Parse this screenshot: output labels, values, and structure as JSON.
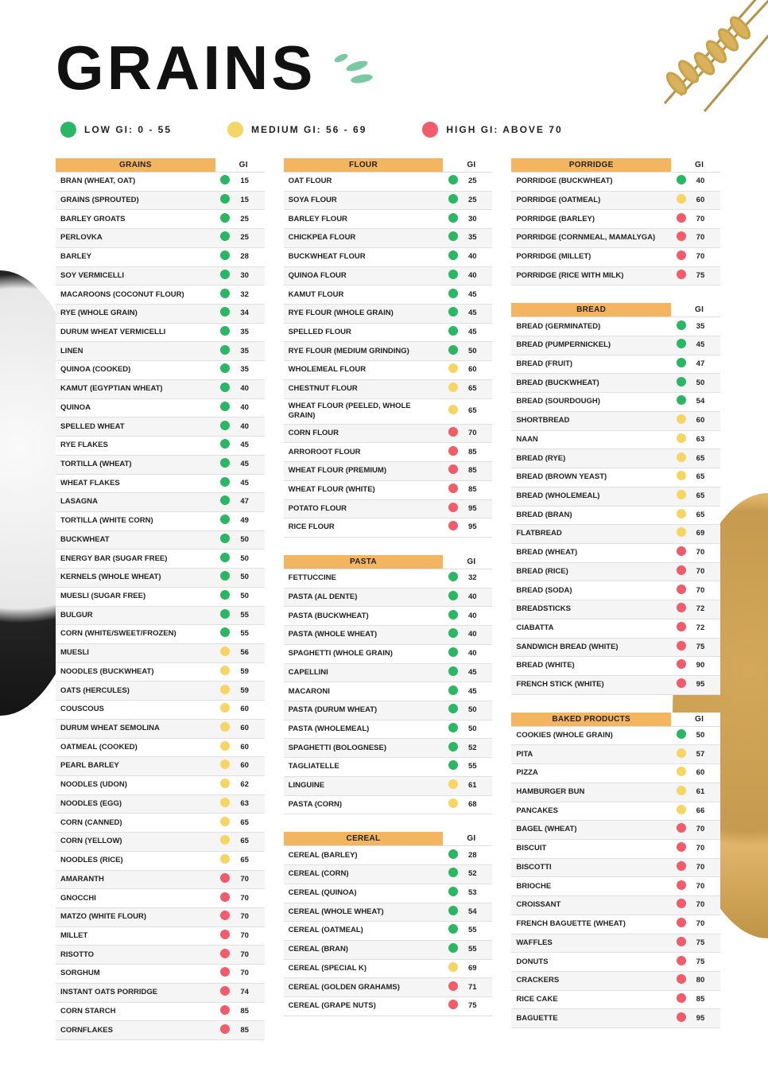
{
  "title": "GRAINS",
  "legend": {
    "low": {
      "label": "LOW GI: 0 - 55",
      "color": "#2ab764"
    },
    "med": {
      "label": "MEDIUM GI: 56 - 69",
      "color": "#f5d564"
    },
    "high": {
      "label": "HIGH GI: ABOVE 70",
      "color": "#f25b6a"
    }
  },
  "gi_header": "GI",
  "tables": {
    "grains": {
      "header": "GRAINS",
      "rows": [
        {
          "name": "BRAN (WHEAT, OAT)",
          "gi": 15,
          "level": "low"
        },
        {
          "name": "GRAINS (SPROUTED)",
          "gi": 15,
          "level": "low"
        },
        {
          "name": "BARLEY GROATS",
          "gi": 25,
          "level": "low"
        },
        {
          "name": "PERLOVKA",
          "gi": 25,
          "level": "low"
        },
        {
          "name": "BARLEY",
          "gi": 28,
          "level": "low"
        },
        {
          "name": "SOY VERMICELLI",
          "gi": 30,
          "level": "low"
        },
        {
          "name": "MACAROONS (COCONUT FLOUR)",
          "gi": 32,
          "level": "low"
        },
        {
          "name": "RYE (WHOLE GRAIN)",
          "gi": 34,
          "level": "low"
        },
        {
          "name": "DURUM WHEAT VERMICELLI",
          "gi": 35,
          "level": "low"
        },
        {
          "name": "LINEN",
          "gi": 35,
          "level": "low"
        },
        {
          "name": "QUINOA (COOKED)",
          "gi": 35,
          "level": "low"
        },
        {
          "name": "KAMUT (EGYPTIAN WHEAT)",
          "gi": 40,
          "level": "low"
        },
        {
          "name": "QUINOA",
          "gi": 40,
          "level": "low"
        },
        {
          "name": "SPELLED WHEAT",
          "gi": 40,
          "level": "low"
        },
        {
          "name": "RYE FLAKES",
          "gi": 45,
          "level": "low"
        },
        {
          "name": "TORTILLA (WHEAT)",
          "gi": 45,
          "level": "low"
        },
        {
          "name": "WHEAT FLAKES",
          "gi": 45,
          "level": "low"
        },
        {
          "name": "LASAGNA",
          "gi": 47,
          "level": "low"
        },
        {
          "name": "TORTILLA (WHITE CORN)",
          "gi": 49,
          "level": "low"
        },
        {
          "name": "BUCKWHEAT",
          "gi": 50,
          "level": "low"
        },
        {
          "name": "ENERGY BAR (SUGAR FREE)",
          "gi": 50,
          "level": "low"
        },
        {
          "name": "KERNELS (WHOLE WHEAT)",
          "gi": 50,
          "level": "low"
        },
        {
          "name": "MUESLI (SUGAR FREE)",
          "gi": 50,
          "level": "low"
        },
        {
          "name": "BULGUR",
          "gi": 55,
          "level": "low"
        },
        {
          "name": "CORN (WHITE/SWEET/FROZEN)",
          "gi": 55,
          "level": "low"
        },
        {
          "name": "MUESLI",
          "gi": 56,
          "level": "med"
        },
        {
          "name": "NOODLES (BUCKWHEAT)",
          "gi": 59,
          "level": "med"
        },
        {
          "name": "OATS (HERCULES)",
          "gi": 59,
          "level": "med"
        },
        {
          "name": "COUSCOUS",
          "gi": 60,
          "level": "med"
        },
        {
          "name": "DURUM WHEAT SEMOLINA",
          "gi": 60,
          "level": "med"
        },
        {
          "name": "OATMEAL (COOKED)",
          "gi": 60,
          "level": "med"
        },
        {
          "name": "PEARL BARLEY",
          "gi": 60,
          "level": "med"
        },
        {
          "name": "NOODLES (UDON)",
          "gi": 62,
          "level": "med"
        },
        {
          "name": "NOODLES (EGG)",
          "gi": 63,
          "level": "med"
        },
        {
          "name": "CORN (CANNED)",
          "gi": 65,
          "level": "med"
        },
        {
          "name": "CORN (YELLOW)",
          "gi": 65,
          "level": "med"
        },
        {
          "name": "NOODLES (RICE)",
          "gi": 65,
          "level": "med"
        },
        {
          "name": "AMARANTH",
          "gi": 70,
          "level": "high"
        },
        {
          "name": "GNOCCHI",
          "gi": 70,
          "level": "high"
        },
        {
          "name": "MATZO (WHITE FLOUR)",
          "gi": 70,
          "level": "high"
        },
        {
          "name": "MILLET",
          "gi": 70,
          "level": "high"
        },
        {
          "name": "RISOTTO",
          "gi": 70,
          "level": "high"
        },
        {
          "name": "SORGHUM",
          "gi": 70,
          "level": "high"
        },
        {
          "name": "INSTANT OATS PORRIDGE",
          "gi": 74,
          "level": "high"
        },
        {
          "name": "CORN STARCH",
          "gi": 85,
          "level": "high"
        },
        {
          "name": "CORNFLAKES",
          "gi": 85,
          "level": "high"
        }
      ]
    },
    "flour": {
      "header": "FLOUR",
      "rows": [
        {
          "name": "OAT FLOUR",
          "gi": 25,
          "level": "low"
        },
        {
          "name": "SOYA FLOUR",
          "gi": 25,
          "level": "low"
        },
        {
          "name": "BARLEY FLOUR",
          "gi": 30,
          "level": "low"
        },
        {
          "name": "CHICKPEA FLOUR",
          "gi": 35,
          "level": "low"
        },
        {
          "name": "BUCKWHEAT FLOUR",
          "gi": 40,
          "level": "low"
        },
        {
          "name": "QUINOA FLOUR",
          "gi": 40,
          "level": "low"
        },
        {
          "name": "KAMUT FLOUR",
          "gi": 45,
          "level": "low"
        },
        {
          "name": "RYE FLOUR (WHOLE GRAIN)",
          "gi": 45,
          "level": "low"
        },
        {
          "name": "SPELLED FLOUR",
          "gi": 45,
          "level": "low"
        },
        {
          "name": "RYE FLOUR (MEDIUM GRINDING)",
          "gi": 50,
          "level": "low"
        },
        {
          "name": "WHOLEMEAL FLOUR",
          "gi": 60,
          "level": "med"
        },
        {
          "name": "CHESTNUT FLOUR",
          "gi": 65,
          "level": "med"
        },
        {
          "name": "WHEAT FLOUR (PEELED, WHOLE GRAIN)",
          "gi": 65,
          "level": "med"
        },
        {
          "name": "CORN FLOUR",
          "gi": 70,
          "level": "high"
        },
        {
          "name": "ARROROOT FLOUR",
          "gi": 85,
          "level": "high"
        },
        {
          "name": "WHEAT FLOUR (PREMIUM)",
          "gi": 85,
          "level": "high"
        },
        {
          "name": "WHEAT FLOUR (WHITE)",
          "gi": 85,
          "level": "high"
        },
        {
          "name": "POTATO FLOUR",
          "gi": 95,
          "level": "high"
        },
        {
          "name": "RICE FLOUR",
          "gi": 95,
          "level": "high"
        }
      ]
    },
    "pasta": {
      "header": "PASTA",
      "rows": [
        {
          "name": "FETTUCCINE",
          "gi": 32,
          "level": "low"
        },
        {
          "name": "PASTA (AL DENTE)",
          "gi": 40,
          "level": "low"
        },
        {
          "name": "PASTA (BUCKWHEAT)",
          "gi": 40,
          "level": "low"
        },
        {
          "name": "PASTA (WHOLE WHEAT)",
          "gi": 40,
          "level": "low"
        },
        {
          "name": "SPAGHETTI (WHOLE GRAIN)",
          "gi": 40,
          "level": "low"
        },
        {
          "name": "CAPELLINI",
          "gi": 45,
          "level": "low"
        },
        {
          "name": "MACARONI",
          "gi": 45,
          "level": "low"
        },
        {
          "name": "PASTA (DURUM WHEAT)",
          "gi": 50,
          "level": "low"
        },
        {
          "name": "PASTA (WHOLEMEAL)",
          "gi": 50,
          "level": "low"
        },
        {
          "name": "SPAGHETTI (BOLOGNESE)",
          "gi": 52,
          "level": "low"
        },
        {
          "name": "TAGLIATELLE",
          "gi": 55,
          "level": "low"
        },
        {
          "name": "LINGUINE",
          "gi": 61,
          "level": "med"
        },
        {
          "name": "PASTA (CORN)",
          "gi": 68,
          "level": "med"
        }
      ]
    },
    "cereal": {
      "header": "CEREAL",
      "rows": [
        {
          "name": "CEREAL (BARLEY)",
          "gi": 28,
          "level": "low"
        },
        {
          "name": "CEREAL (CORN)",
          "gi": 52,
          "level": "low"
        },
        {
          "name": "CEREAL (QUINOA)",
          "gi": 53,
          "level": "low"
        },
        {
          "name": "CEREAL (WHOLE WHEAT)",
          "gi": 54,
          "level": "low"
        },
        {
          "name": "CEREAL (OATMEAL)",
          "gi": 55,
          "level": "low"
        },
        {
          "name": "CEREAL (BRAN)",
          "gi": 55,
          "level": "low"
        },
        {
          "name": "CEREAL (SPECIAL K)",
          "gi": 69,
          "level": "med"
        },
        {
          "name": "CEREAL (GOLDEN GRAHAMS)",
          "gi": 71,
          "level": "high"
        },
        {
          "name": "CEREAL (GRAPE NUTS)",
          "gi": 75,
          "level": "high"
        }
      ]
    },
    "porridge": {
      "header": "PORRIDGE",
      "rows": [
        {
          "name": "PORRIDGE (BUCKWHEAT)",
          "gi": 40,
          "level": "low"
        },
        {
          "name": "PORRIDGE (OATMEAL)",
          "gi": 60,
          "level": "med"
        },
        {
          "name": "PORRIDGE (BARLEY)",
          "gi": 70,
          "level": "high"
        },
        {
          "name": "PORRIDGE (CORNMEAL, MAMALYGA)",
          "gi": 70,
          "level": "high"
        },
        {
          "name": "PORRIDGE (MILLET)",
          "gi": 70,
          "level": "high"
        },
        {
          "name": "PORRIDGE (RICE WITH MILK)",
          "gi": 75,
          "level": "high"
        }
      ]
    },
    "bread": {
      "header": "BREAD",
      "rows": [
        {
          "name": "BREAD (GERMINATED)",
          "gi": 35,
          "level": "low"
        },
        {
          "name": "BREAD (PUMPERNICKEL)",
          "gi": 45,
          "level": "low"
        },
        {
          "name": "BREAD (FRUIT)",
          "gi": 47,
          "level": "low"
        },
        {
          "name": "BREAD (BUCKWHEAT)",
          "gi": 50,
          "level": "low"
        },
        {
          "name": "BREAD (SOURDOUGH)",
          "gi": 54,
          "level": "low"
        },
        {
          "name": "SHORTBREAD",
          "gi": 60,
          "level": "med"
        },
        {
          "name": "NAAN",
          "gi": 63,
          "level": "med"
        },
        {
          "name": "BREAD (RYE)",
          "gi": 65,
          "level": "med"
        },
        {
          "name": "BREAD (BROWN YEAST)",
          "gi": 65,
          "level": "med"
        },
        {
          "name": "BREAD (WHOLEMEAL)",
          "gi": 65,
          "level": "med"
        },
        {
          "name": "BREAD (BRAN)",
          "gi": 65,
          "level": "med"
        },
        {
          "name": "FLATBREAD",
          "gi": 69,
          "level": "med"
        },
        {
          "name": "BREAD (WHEAT)",
          "gi": 70,
          "level": "high"
        },
        {
          "name": "BREAD (RICE)",
          "gi": 70,
          "level": "high"
        },
        {
          "name": "BREAD (SODA)",
          "gi": 70,
          "level": "high"
        },
        {
          "name": "BREADSTICKS",
          "gi": 72,
          "level": "high"
        },
        {
          "name": "CIABATTA",
          "gi": 72,
          "level": "high"
        },
        {
          "name": "SANDWICH BREAD (WHITE)",
          "gi": 75,
          "level": "high"
        },
        {
          "name": "BREAD (WHITE)",
          "gi": 90,
          "level": "high"
        },
        {
          "name": "FRENCH STICK (WHITE)",
          "gi": 95,
          "level": "high"
        }
      ]
    },
    "baked": {
      "header": "BAKED PRODUCTS",
      "rows": [
        {
          "name": "COOKIES (WHOLE GRAIN)",
          "gi": 50,
          "level": "low"
        },
        {
          "name": "PITA",
          "gi": 57,
          "level": "med"
        },
        {
          "name": "PIZZA",
          "gi": 60,
          "level": "med"
        },
        {
          "name": "HAMBURGER BUN",
          "gi": 61,
          "level": "med"
        },
        {
          "name": "PANCAKES",
          "gi": 66,
          "level": "med"
        },
        {
          "name": "BAGEL (WHEAT)",
          "gi": 70,
          "level": "high"
        },
        {
          "name": "BISCUIT",
          "gi": 70,
          "level": "high"
        },
        {
          "name": "BISCOTTI",
          "gi": 70,
          "level": "high"
        },
        {
          "name": "BRIOCHE",
          "gi": 70,
          "level": "high"
        },
        {
          "name": "CROISSANT",
          "gi": 70,
          "level": "high"
        },
        {
          "name": "FRENCH BAGUETTE (WHEAT)",
          "gi": 70,
          "level": "high"
        },
        {
          "name": "WAFFLES",
          "gi": 75,
          "level": "high"
        },
        {
          "name": "DONUTS",
          "gi": 75,
          "level": "high"
        },
        {
          "name": "CRACKERS",
          "gi": 80,
          "level": "high"
        },
        {
          "name": "RICE CAKE",
          "gi": 85,
          "level": "high"
        },
        {
          "name": "BAGUETTE",
          "gi": 95,
          "level": "high"
        }
      ]
    }
  },
  "chart_data": {
    "type": "table",
    "title": "GRAINS — Glycemic Index",
    "legend": [
      {
        "label": "LOW GI",
        "range": "0 - 55",
        "color": "#2ab764"
      },
      {
        "label": "MEDIUM GI",
        "range": "56 - 69",
        "color": "#f5d564"
      },
      {
        "label": "HIGH GI",
        "range": "ABOVE 70",
        "color": "#f25b6a"
      }
    ],
    "sections": [
      "GRAINS",
      "FLOUR",
      "PASTA",
      "CEREAL",
      "PORRIDGE",
      "BREAD",
      "BAKED PRODUCTS"
    ]
  }
}
